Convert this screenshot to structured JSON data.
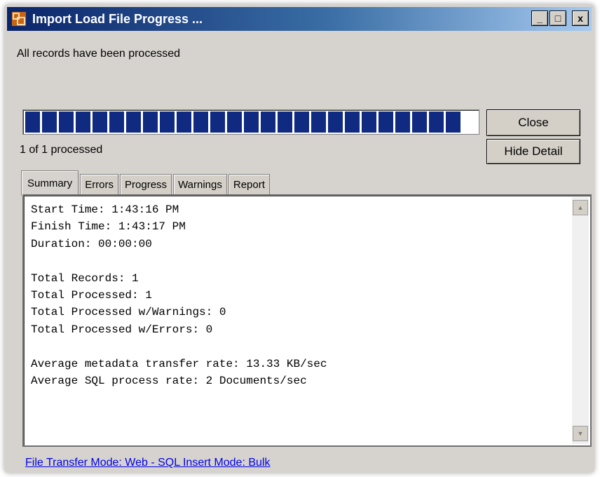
{
  "window": {
    "title": "Import Load File Progress ...",
    "controls": {
      "minimize": "_",
      "maximize": "□",
      "close": "x"
    }
  },
  "status_message": "All records have been processed",
  "progress": {
    "fraction": 1.0,
    "segments_shown": 26,
    "count_text": "1 of 1 processed",
    "fill_color": "#0f2a80"
  },
  "buttons": {
    "close": "Close",
    "hide_detail": "Hide Detail"
  },
  "tabs": [
    {
      "label": "Summary",
      "active": true
    },
    {
      "label": "Errors",
      "active": false
    },
    {
      "label": "Progress",
      "active": false
    },
    {
      "label": "Warnings",
      "active": false
    },
    {
      "label": "Report",
      "active": false
    }
  ],
  "summary_lines": [
    "Start Time: 1:43:16 PM",
    "Finish Time: 1:43:17 PM",
    "Duration: 00:00:00",
    "",
    "Total Records: 1",
    "Total Processed: 1",
    "Total Processed w/Warnings: 0",
    "Total Processed w/Errors: 0",
    "",
    "Average metadata transfer rate: 13.33 KB/sec",
    "Average SQL process rate: 2 Documents/sec"
  ],
  "footer_link": "File Transfer Mode: Web - SQL Insert Mode: Bulk",
  "icons": {
    "app": "import-window-icon",
    "scroll_up": "scroll-up-arrow-icon",
    "scroll_down": "scroll-down-arrow-icon"
  },
  "colors": {
    "titlebar_start": "#0a246a",
    "titlebar_end": "#a6caf0",
    "link": "#0000ee"
  }
}
